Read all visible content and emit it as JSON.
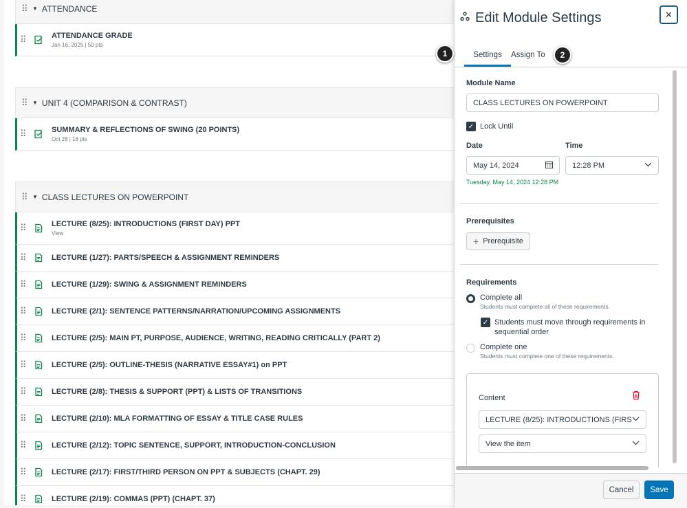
{
  "modules": [
    {
      "name": "ATTENDANCE",
      "items": [
        {
          "title": "ATTENDANCE GRADE",
          "sub": "Jan 16, 2025  |  50 pts"
        }
      ]
    },
    {
      "name": "UNIT 4 (COMPARISON & CONTRAST)",
      "items": [
        {
          "title": "SUMMARY & REFLECTIONS OF SWING (20 POINTS)",
          "sub": "Oct 28  |  16 pts"
        }
      ]
    },
    {
      "name": "CLASS LECTURES ON POWERPOINT",
      "items": [
        {
          "title": "LECTURE (8/25): INTRODUCTIONS (FIRST DAY) PPT",
          "sub": "View"
        },
        {
          "title": "LECTURE (1/27): PARTS/SPEECH & ASSIGNMENT REMINDERS"
        },
        {
          "title": "LECTURE (1/29): SWING & ASSIGNMENT REMINDERS"
        },
        {
          "title": "LECTURE (2/1): SENTENCE PATTERNS/NARRATION/UPCOMING ASSIGNMENTS"
        },
        {
          "title": "LECTURE (2/5): MAIN PT, PURPOSE, AUDIENCE, WRITING, READING CRITICALLY (PART 2)"
        },
        {
          "title": "LECTURE (2/5): OUTLINE-THESIS (NARRATIVE ESSAY#1) on PPT"
        },
        {
          "title": "LECTURE (2/8): THESIS & SUPPORT (PPT) & LISTS OF TRANSITIONS"
        },
        {
          "title": "LECTURE (2/10): MLA FORMATTING OF ESSAY & TITLE CASE RULES"
        },
        {
          "title": "LECTURE (2/12): TOPIC SENTENCE, SUPPORT, INTRODUCTION-CONCLUSION"
        },
        {
          "title": "LECTURE (2/17): FIRST/THIRD PERSON ON PPT & SUBJECTS (CHAPT. 29)"
        },
        {
          "title": "LECTURE (2/19): COMMAS (PPT) (CHAPT. 37)"
        }
      ]
    }
  ],
  "tray": {
    "title": "Edit Module Settings",
    "close_label": "✕",
    "tabs": [
      "Settings",
      "Assign To"
    ],
    "badges": [
      "1",
      "2"
    ],
    "module_name_label": "Module Name",
    "module_name_value": "CLASS LECTURES ON POWERPOINT",
    "lock_until_label": "Lock Until",
    "date_label": "Date",
    "date_value": "May 14, 2024",
    "time_label": "Time",
    "time_value": "12:28 PM",
    "date_summary": "Tuesday, May 14, 2024 12:28 PM",
    "prerequisites_label": "Prerequisites",
    "prerequisite_button": "Prerequisite",
    "requirements_label": "Requirements",
    "complete_all_label": "Complete all",
    "complete_all_help": "Students must complete all of these requirements.",
    "sequential_label": "Students must move through requirements in sequential order",
    "complete_one_label": "Complete one",
    "complete_one_help": "Students must complete one of these requirements.",
    "content_label": "Content",
    "content_value": "LECTURE (8/25): INTRODUCTIONS (FIRS",
    "action_value": "View the item",
    "cancel_label": "Cancel",
    "save_label": "Save"
  },
  "colors": {
    "accent": "#0374b5",
    "published_green": "#0b874b",
    "delete_red": "#e0061f"
  }
}
